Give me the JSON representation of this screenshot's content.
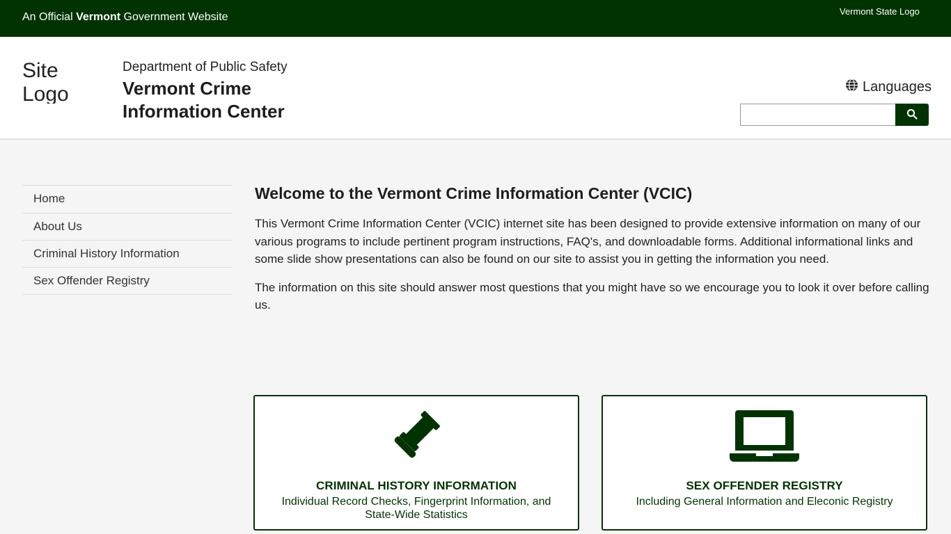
{
  "gov_bar": {
    "prefix": "An Official ",
    "state": "Vermont",
    "suffix": " Government Website",
    "state_logo_alt": "Vermont State Logo"
  },
  "header": {
    "site_logo_alt": "Site Logo",
    "department": "Department of Public Safety",
    "title": "Vermont Crime Information Center",
    "languages_label": "Languages",
    "search_value": "",
    "search_placeholder": ""
  },
  "sidebar": {
    "items": [
      {
        "label": "Home"
      },
      {
        "label": "About Us"
      },
      {
        "label": "Criminal History Information"
      },
      {
        "label": "Sex Offender Registry"
      }
    ]
  },
  "main": {
    "heading": "Welcome to the Vermont Crime Information Center (VCIC)",
    "paragraphs": [
      "This Vermont Crime Information Center (VCIC) internet site has been designed to provide extensive information on many of our various programs to include pertinent program instructions, FAQ's, and downloadable forms.  Additional informational links and some slide show presentations can also be found on our site to assist you in getting the information you need.",
      "The information on this site should answer most questions that you might have so we encourage you to look it over before calling us."
    ]
  },
  "cards": [
    {
      "icon": "gavel-icon",
      "title": "CRIMINAL HISTORY INFORMATION",
      "description": "Individual Record Checks, Fingerprint Information, and State-Wide Statistics"
    },
    {
      "icon": "laptop-icon",
      "title": "SEX OFFENDER REGISTRY",
      "description": "Including General Information and Eleconic Registry"
    }
  ],
  "colors": {
    "brand_green": "#003300",
    "page_background": "#f5f5f5"
  }
}
